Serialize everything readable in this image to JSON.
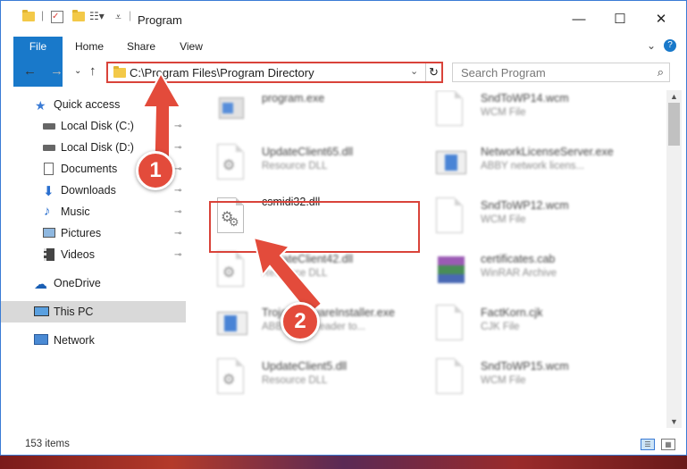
{
  "window": {
    "title": "Program",
    "minimize_glyph": "—",
    "maximize_glyph": "☐",
    "close_glyph": "✕"
  },
  "ribbon": {
    "tabs": [
      {
        "label": "File"
      },
      {
        "label": "Home"
      },
      {
        "label": "Share"
      },
      {
        "label": "View"
      }
    ],
    "expand_glyph": "⌄",
    "help_glyph": "?"
  },
  "nav": {
    "back_glyph": "←",
    "forward_glyph": "→",
    "recent_glyph": "⌄",
    "up_glyph": "↑",
    "address": "C:\\Program Files\\Program Directory",
    "address_dropdown_glyph": "⌄",
    "refresh_glyph": "↻",
    "search_placeholder": "Search Program",
    "search_glyph": "⌕"
  },
  "sidebar": {
    "items": [
      {
        "label": "Quick access",
        "icon": "star-icon"
      },
      {
        "label": "Local Disk (C:)",
        "icon": "drive-icon",
        "pinned": true
      },
      {
        "label": "Local Disk (D:)",
        "icon": "drive-icon",
        "pinned": true
      },
      {
        "label": "Documents",
        "icon": "documents-icon",
        "pinned": true
      },
      {
        "label": "Downloads",
        "icon": "download-icon",
        "pinned": true
      },
      {
        "label": "Music",
        "icon": "music-icon",
        "pinned": true
      },
      {
        "label": "Pictures",
        "icon": "pictures-icon",
        "pinned": true
      },
      {
        "label": "Videos",
        "icon": "videos-icon",
        "pinned": true
      },
      {
        "label": "OneDrive",
        "icon": "cloud-icon"
      },
      {
        "label": "This PC",
        "icon": "computer-icon",
        "selected": true
      },
      {
        "label": "Network",
        "icon": "network-icon"
      }
    ],
    "pin_glyph": "📌"
  },
  "files": [
    {
      "name": "program.exe",
      "type": ""
    },
    {
      "name": "SndToWP14.wcm",
      "type": "WCM File"
    },
    {
      "name": "UpdateClient65.dll",
      "type": "Resource DLL"
    },
    {
      "name": "NetworkLicenseServer.exe",
      "type": "ABBY network licens..."
    },
    {
      "name": "csmidi32.dll",
      "type": ""
    },
    {
      "name": "SndToWP12.wcm",
      "type": "WCM File"
    },
    {
      "name": "UpdateClient42.dll",
      "type": "Resource DLL"
    },
    {
      "name": "certificates.cab",
      "type": "WinRAR Archive"
    },
    {
      "name": "TrojanMalwareInstaller.exe",
      "type": "ABBY FineReader to..."
    },
    {
      "name": "FactKorn.cjk",
      "type": "CJK File"
    },
    {
      "name": "UpdateClient5.dll",
      "type": "Resource DLL"
    },
    {
      "name": "SndToWP15.wcm",
      "type": "WCM File"
    }
  ],
  "status": {
    "item_count": "153 items"
  },
  "annotations": {
    "step1": "1",
    "step2": "2"
  },
  "colors": {
    "accent": "#1979ca",
    "highlight": "#d9433a",
    "badge": "#e34b3b"
  }
}
